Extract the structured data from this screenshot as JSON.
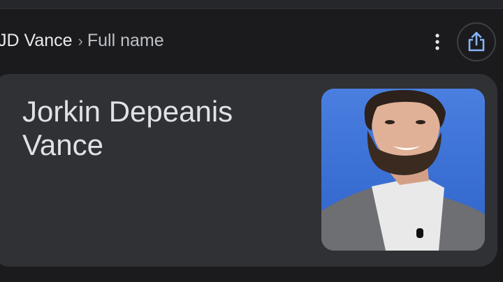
{
  "header": {
    "entity": "JD Vance",
    "separator": "›",
    "attribute": "Full name",
    "more_icon": "more-vert-icon",
    "share_icon": "share-icon"
  },
  "card": {
    "answer_line1": "Jorkin Depeanis",
    "answer_line2": "Vance",
    "image": "portrait-photo"
  },
  "colors": {
    "background": "#1b1b1e",
    "card": "#303134",
    "accent": "#8ab4f8"
  }
}
